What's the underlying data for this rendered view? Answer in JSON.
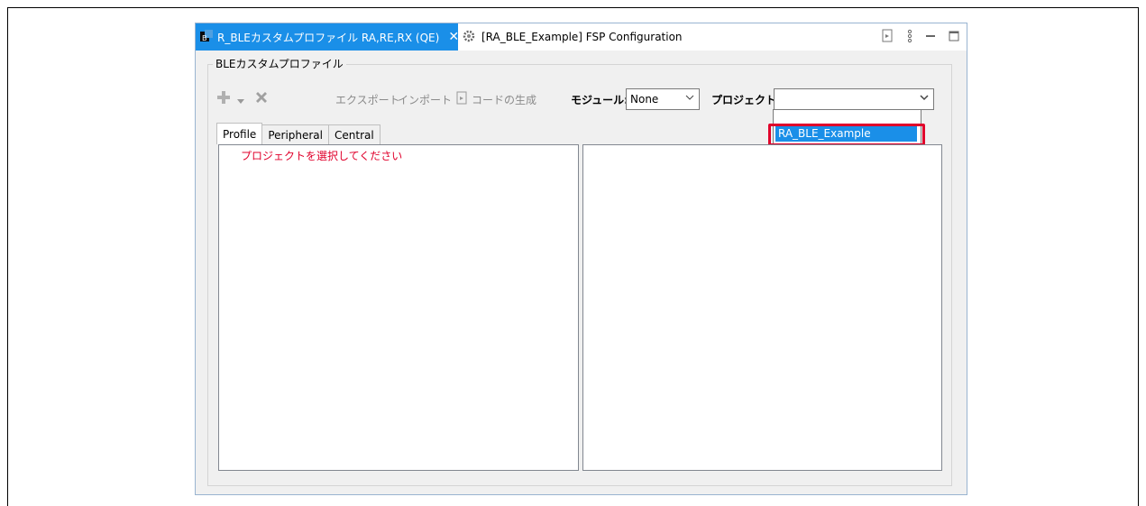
{
  "tabs": {
    "active_label": "R_BLEカスタムプロファイル RA,RE,RX (QE)",
    "inactive_label": "[RA_BLE_Example] FSP Configuration"
  },
  "group": {
    "title": "BLEカスタムプロファイル"
  },
  "toolbar": {
    "export_label": "エクスポート",
    "import_label": "インポート",
    "generate_label": "コードの生成",
    "module_label": "モジュール:",
    "module_value": "None",
    "project_label": "プロジェクト:",
    "project_value": ""
  },
  "dropdown": {
    "option": "RA_BLE_Example"
  },
  "inner_tabs": [
    "Profile",
    "Peripheral",
    "Central"
  ],
  "left_panel": {
    "message": "プロジェクトを選択してください"
  },
  "colors": {
    "accent": "#1a8fe8",
    "highlight": "#e0002b",
    "message": "#e0002b"
  }
}
